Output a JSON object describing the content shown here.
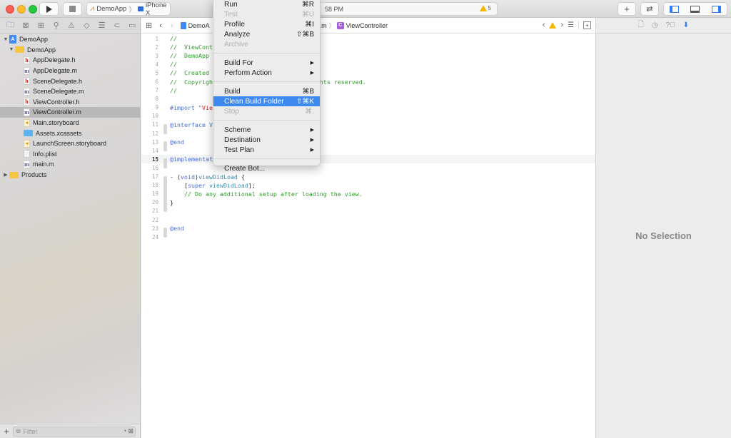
{
  "toolbar": {
    "scheme_app": "DemoApp",
    "scheme_device": "iPhone X",
    "status_text": "58 PM",
    "warning_count": "5",
    "add_icon": "+",
    "swap_icon": "⇄"
  },
  "navigator": {
    "tabs": [
      "project-navigator",
      "source-control",
      "symbol-navigator",
      "find-navigator",
      "issue-navigator",
      "test-navigator",
      "debug-navigator",
      "breakpoint-navigator",
      "report-navigator"
    ],
    "tree": [
      {
        "label": "DemoApp",
        "type": "project",
        "level": 0,
        "expanded": true
      },
      {
        "label": "DemoApp",
        "type": "folder",
        "level": 1,
        "expanded": true
      },
      {
        "label": "AppDelegate.h",
        "type": "h",
        "level": 2
      },
      {
        "label": "AppDelegate.m",
        "type": "m",
        "level": 2
      },
      {
        "label": "SceneDelegate.h",
        "type": "h",
        "level": 2
      },
      {
        "label": "SceneDelegate.m",
        "type": "m",
        "level": 2
      },
      {
        "label": "ViewController.h",
        "type": "h",
        "level": 2
      },
      {
        "label": "ViewController.m",
        "type": "m",
        "level": 2,
        "selected": true
      },
      {
        "label": "Main.storyboard",
        "type": "storyboard",
        "level": 2
      },
      {
        "label": "Assets.xcassets",
        "type": "assets",
        "level": 2
      },
      {
        "label": "LaunchScreen.storyboard",
        "type": "storyboard",
        "level": 2
      },
      {
        "label": "Info.plist",
        "type": "plist",
        "level": 2
      },
      {
        "label": "main.m",
        "type": "m",
        "level": 2
      },
      {
        "label": "Products",
        "type": "folder",
        "level": 0,
        "expanded": false
      }
    ],
    "filter_placeholder": "Filter"
  },
  "editor": {
    "breadcrumb": {
      "project": "DemoA",
      "file_suffix": ".m",
      "symbol": "ViewController"
    },
    "current_line": 15,
    "lines": [
      {
        "n": "1",
        "parts": [
          {
            "t": "//",
            "c": "comment"
          }
        ]
      },
      {
        "n": "2",
        "parts": [
          {
            "t": "//  ViewCont",
            "c": "comment"
          }
        ]
      },
      {
        "n": "3",
        "parts": [
          {
            "t": "//  DemoApp",
            "c": "comment"
          }
        ]
      },
      {
        "n": "4",
        "parts": [
          {
            "t": "//",
            "c": "comment"
          }
        ]
      },
      {
        "n": "5",
        "parts": [
          {
            "t": "//  Created",
            "c": "comment"
          }
        ]
      },
      {
        "n": "6",
        "parts": [
          {
            "t": "//  Copyrigh",
            "c": "comment"
          },
          {
            "t": "                            ights reserved.",
            "c": "comment"
          }
        ]
      },
      {
        "n": "7",
        "parts": [
          {
            "t": "//",
            "c": "comment"
          }
        ]
      },
      {
        "n": "8",
        "parts": []
      },
      {
        "n": "9",
        "parts": [
          {
            "t": "#import ",
            "c": "keyword"
          },
          {
            "t": "\"Vie",
            "c": "str"
          }
        ]
      },
      {
        "n": "10",
        "parts": []
      },
      {
        "n": "11",
        "parts": [
          {
            "t": "@interface ",
            "c": "keyword"
          },
          {
            "t": "V",
            "c": "func"
          }
        ],
        "mark": true
      },
      {
        "n": "12",
        "parts": []
      },
      {
        "n": "13",
        "parts": [
          {
            "t": "@end",
            "c": "keyword"
          }
        ],
        "mark": true
      },
      {
        "n": "14",
        "parts": []
      },
      {
        "n": "15",
        "parts": [
          {
            "t": "@implementat",
            "c": "keyword"
          }
        ],
        "mark": true
      },
      {
        "n": "16",
        "parts": []
      },
      {
        "n": "17",
        "parts": [
          {
            "t": "- (",
            "c": "txt"
          },
          {
            "t": "void",
            "c": "keyword"
          },
          {
            "t": ")",
            "c": "txt"
          },
          {
            "t": "viewDidLoad",
            "c": "func"
          },
          {
            "t": " {",
            "c": "txt"
          }
        ],
        "mark": true
      },
      {
        "n": "18",
        "parts": [
          {
            "t": "    [",
            "c": "txt"
          },
          {
            "t": "super",
            "c": "keyword"
          },
          {
            "t": " ",
            "c": "txt"
          },
          {
            "t": "viewDidLoad",
            "c": "func"
          },
          {
            "t": "];",
            "c": "txt"
          }
        ],
        "mark": true
      },
      {
        "n": "19",
        "parts": [
          {
            "t": "    // Do any additional setup after loading the view.",
            "c": "comment"
          }
        ],
        "mark": true
      },
      {
        "n": "20",
        "parts": [
          {
            "t": "}",
            "c": "txt"
          }
        ],
        "mark": true
      },
      {
        "n": "21",
        "parts": []
      },
      {
        "n": "22",
        "parts": []
      },
      {
        "n": "23",
        "parts": [
          {
            "t": "@end",
            "c": "keyword"
          }
        ],
        "mark": true
      },
      {
        "n": "24",
        "parts": []
      }
    ]
  },
  "inspector": {
    "no_selection": "No Selection"
  },
  "product_menu": {
    "items": [
      {
        "label": "Run",
        "shortcut": "⌘R"
      },
      {
        "label": "Test",
        "shortcut": "⌘U",
        "disabled": true
      },
      {
        "label": "Profile",
        "shortcut": "⌘I"
      },
      {
        "label": "Analyze",
        "shortcut": "⇧⌘B"
      },
      {
        "label": "Archive",
        "disabled": true
      },
      {
        "separator": true
      },
      {
        "label": "Build For",
        "submenu": true
      },
      {
        "label": "Perform Action",
        "submenu": true
      },
      {
        "separator": true
      },
      {
        "label": "Build",
        "shortcut": "⌘B"
      },
      {
        "label": "Clean Build Folder",
        "shortcut": "⇧⌘K",
        "highlighted": true
      },
      {
        "label": "Stop",
        "shortcut": "⌘.",
        "disabled": true
      },
      {
        "separator": true
      },
      {
        "label": "Scheme",
        "submenu": true
      },
      {
        "label": "Destination",
        "submenu": true
      },
      {
        "label": "Test Plan",
        "submenu": true
      },
      {
        "separator": true
      },
      {
        "label": "Create Bot..."
      }
    ]
  },
  "colors": {
    "accent": "#3d89ef",
    "comment": "#2c9e27",
    "keyword": "#4a6fd4",
    "warning": "#f6b500"
  }
}
